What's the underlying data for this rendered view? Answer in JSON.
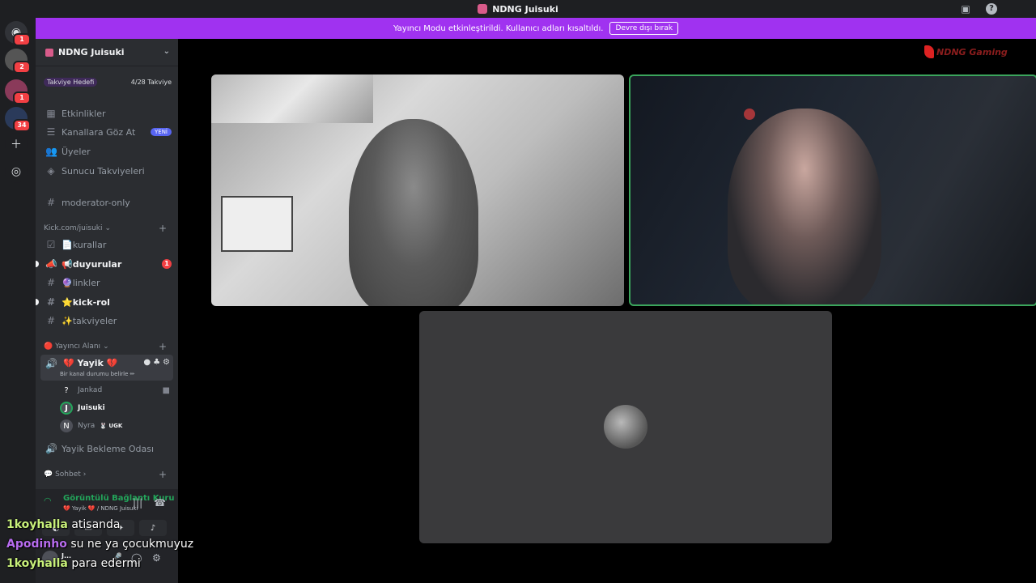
{
  "window": {
    "title": "NDNG Juisuki"
  },
  "titlebar_icons": [
    "screen-share-icon",
    "help-icon"
  ],
  "rail": {
    "servers": [
      {
        "name": "discord-home",
        "badge": "1"
      },
      {
        "name": "server-avatar-1",
        "badge": "2"
      },
      {
        "name": "server-avatar-2",
        "badge": "1"
      },
      {
        "name": "server-avatar-3",
        "badge": "34"
      }
    ]
  },
  "banner": {
    "text": "Yayıncı Modu etkinleştirildi. Kullanıcı adları kısaltıldı.",
    "button": "Devre dışı bırak"
  },
  "guild": {
    "name": "NDNG Juisuki"
  },
  "boost": {
    "goal": "Takviye Hedefi",
    "progress": "4/28 Takviye"
  },
  "nav": {
    "events": "Etkinlikler",
    "browse": "Kanallara Göz At",
    "browse_badge": "YENİ",
    "members": "Üyeler",
    "boosts": "Sunucu Takviyeleri"
  },
  "channels": {
    "moderator": "moderator-only",
    "cat_kick": "Kick.com/juisuki",
    "rules": "📄kurallar",
    "announcements": "📢duyurular",
    "announcements_badge": "1",
    "links": "🔮linkler",
    "kickrole": "⭐kick-rol",
    "boosts": "✨takviyeler",
    "cat_stream": "🔴 Yayıncı Alanı",
    "voice_active": "💔 Yayik 💔",
    "voice_status": "Bir kanal durumu belirle ✏",
    "members": [
      {
        "name": "Jankad",
        "avatar": "?"
      },
      {
        "name": "Juisuki",
        "avatar": "J"
      },
      {
        "name": "Nyra",
        "tag": "🐰 UGK",
        "avatar": "N"
      }
    ],
    "waiting": "Yayik Bekleme Odası",
    "cat_chat": "💬 Sohbet"
  },
  "rtc": {
    "status": "Görüntülü Bağlantı Kuru",
    "sub": "💔 Yayik 💔 / NDNG Juisuki",
    "user": "J..."
  },
  "stage": {
    "logo": "NDNG Gaming"
  },
  "chat": [
    {
      "user": "1koyhalla",
      "message": "atisanda"
    },
    {
      "user": "Apodinho",
      "message": "su ne ya çocukmuyuz"
    },
    {
      "user": "1koyhalla",
      "message": "para edermi"
    }
  ],
  "colors": {
    "banner": "#a032f0",
    "speaking": "#3ba55c",
    "connected": "#23a55a"
  }
}
